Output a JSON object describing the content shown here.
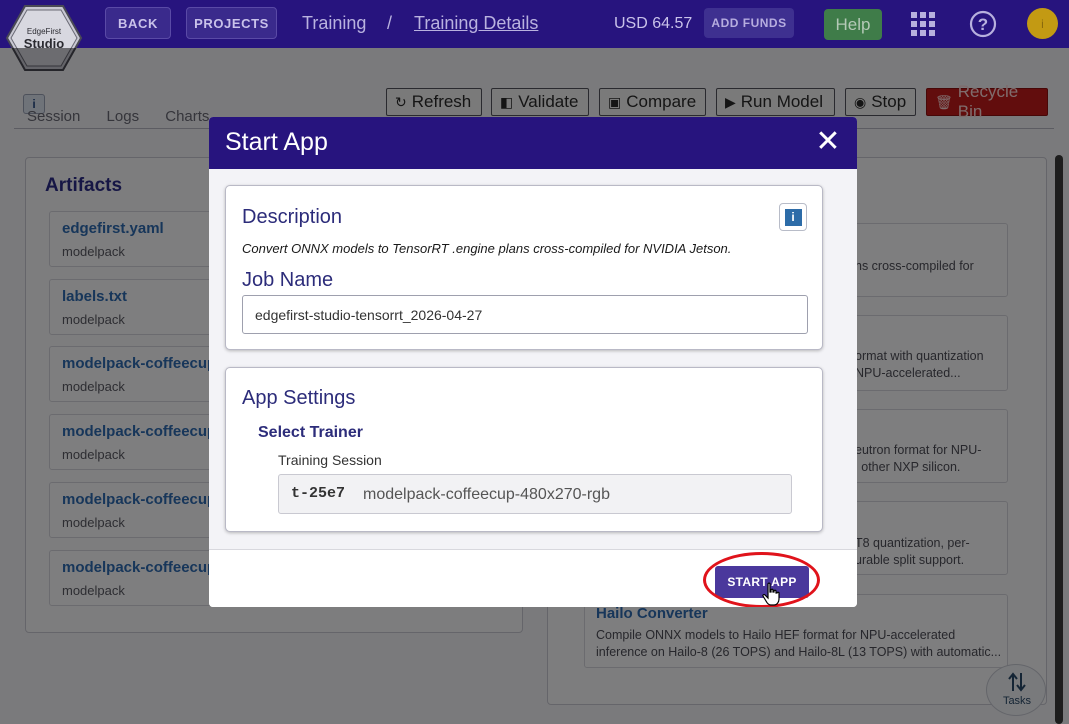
{
  "nav": {
    "logo_line1": "EdgeFirst",
    "logo_line2": "Studio",
    "back_label": "BACK",
    "projects_label": "PROJECTS",
    "crumb_1": "Training",
    "crumb_sep": "/",
    "crumb_2": "Training Details",
    "balance": "USD 64.57",
    "add_funds_label": "ADD FUNDS",
    "help_label": "Help",
    "avatar_initial": "i"
  },
  "page": {
    "tabs": [
      "Session",
      "Logs",
      "Charts"
    ],
    "toolbar": [
      {
        "label": "Refresh",
        "icon": "refresh-icon"
      },
      {
        "label": "Validate",
        "icon": "validate-icon"
      },
      {
        "label": "Compare",
        "icon": "compare-icon"
      },
      {
        "label": "Run Model",
        "icon": "play-icon"
      },
      {
        "label": "Stop",
        "icon": "stop-icon"
      },
      {
        "label": "Recycle Bin",
        "icon": "trash-icon"
      }
    ],
    "artifacts_title": "Artifacts",
    "artifacts": [
      {
        "name": "edgefirst.yaml",
        "sub": "modelpack"
      },
      {
        "name": "labels.txt",
        "sub": "modelpack"
      },
      {
        "name": "modelpack-coffeecup-",
        "sub": "modelpack"
      },
      {
        "name": "modelpack-coffeecup-",
        "sub": "modelpack"
      },
      {
        "name": "modelpack-coffeecup-",
        "sub": "modelpack"
      },
      {
        "name": "modelpack-coffeecup-",
        "sub": "modelpack"
      }
    ],
    "apps_fragments": [
      {
        "line1": "ns cross-compiled for",
        "line2": ""
      },
      {
        "line1": "ormat with quantization",
        "line2": "NPU-accelerated..."
      },
      {
        "line1": "eutron format for NPU-",
        "line2": "l other NXP silicon."
      },
      {
        "line1": "T8 quantization, per-",
        "line2": "urable split support."
      }
    ],
    "hailo": {
      "name": "Hailo Converter",
      "desc_line1": "Compile ONNX models to Hailo HEF format for NPU-accelerated",
      "desc_line2": "inference on Hailo-8 (26 TOPS) and Hailo-8L (13 TOPS) with automatic..."
    },
    "tasks_label": "Tasks"
  },
  "modal": {
    "title": "Start App",
    "description_title": "Description",
    "description_text": "Convert ONNX models to TensorRT .engine plans cross-compiled for NVIDIA Jetson.",
    "job_name_label": "Job Name",
    "job_name_value": "edgefirst-studio-tensorrt_2026-04-27",
    "app_settings_title": "App Settings",
    "select_trainer_label": "Select Trainer",
    "training_session_label": "Training Session",
    "training_session_code": "t-25e7",
    "training_session_name": "modelpack-coffeecup-480x270-rgb",
    "start_button": "START APP"
  },
  "colors": {
    "brand": "#27147e",
    "primary_button": "#4a389c",
    "highlight": "#e0131b",
    "danger": "#c41a1a"
  }
}
